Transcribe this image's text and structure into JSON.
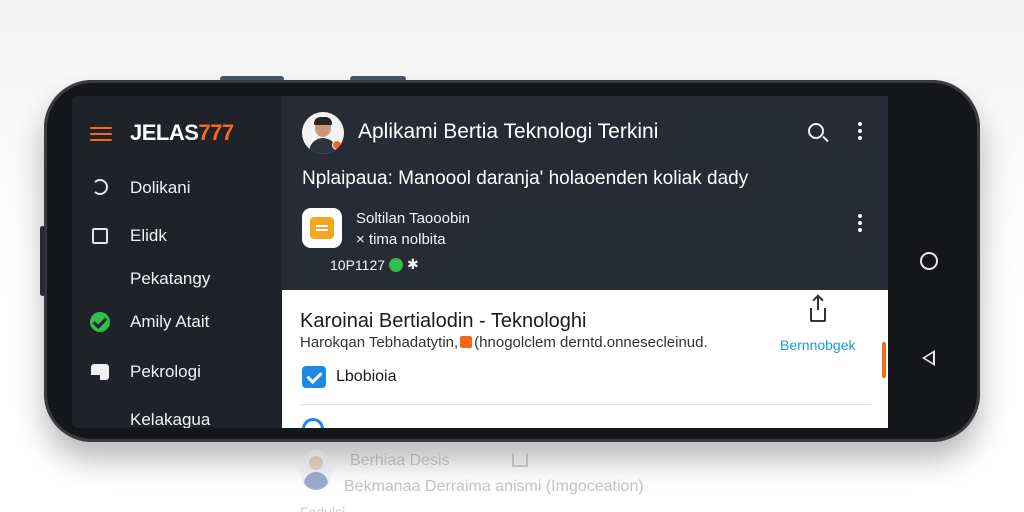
{
  "brand": {
    "part1": "JELAS",
    "part2": "777",
    "accent_color": "#f26b1d"
  },
  "sidebar": {
    "items": [
      {
        "label": "Dolikani",
        "icon": "refresh-icon"
      },
      {
        "label": "Elidk",
        "icon": "square-icon"
      },
      {
        "label": "Pekatangy",
        "icon": ""
      },
      {
        "label": "Amily Atait",
        "icon": "check-circle-icon"
      },
      {
        "label": "Pekrologi",
        "icon": "card-icon"
      },
      {
        "label": "Kelakagua",
        "icon": ""
      }
    ]
  },
  "header": {
    "title": "Aplikami Bertia Teknologi Terkini",
    "headline": "Nplaipaua: Manoool daranja' holaoenden koliak dady"
  },
  "app_item": {
    "name": "Soltilan Taooobin",
    "subtitle": "× tima nolbita",
    "meta": "10P1127",
    "meta_suffix": "✱"
  },
  "card": {
    "title": "Karoinai Bertialodin - Teknologhi",
    "desc_part1": "Harokqan Tebhadatytin,",
    "desc_part2": "(hnogolclem derntd.onnesecleinud.",
    "share_label": "Bernnobgek",
    "checkbox_label": "Lbobioia",
    "link_color": "#1e9bd7"
  },
  "reflection": {
    "title": "Berhiaa Desis",
    "desc": "Bekmanaa Derraima anismi (Imgoceation)",
    "extra": "Fodulsi"
  }
}
